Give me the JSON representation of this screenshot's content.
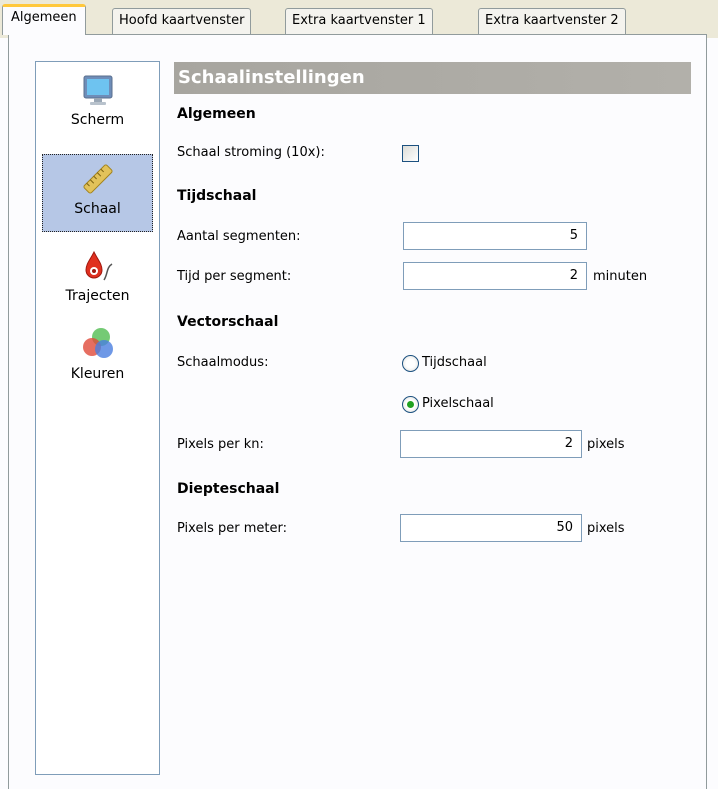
{
  "tabs": [
    {
      "label": "Algemeen",
      "active": true
    },
    {
      "label": "Hoofd kaartvenster",
      "active": false
    },
    {
      "label": "Extra kaartvenster 1",
      "active": false
    },
    {
      "label": "Extra kaartvenster 2",
      "active": false
    }
  ],
  "sidebar": {
    "items": [
      {
        "label": "Scherm",
        "icon": "monitor-icon"
      },
      {
        "label": "Schaal",
        "icon": "ruler-icon",
        "selected": true
      },
      {
        "label": "Trajecten",
        "icon": "track-icon"
      },
      {
        "label": "Kleuren",
        "icon": "colors-icon"
      }
    ]
  },
  "main": {
    "header": "Schaalinstellingen",
    "general": {
      "title": "Algemeen",
      "flow_scale_label": "Schaal stroming (10x):",
      "flow_scale_checked": false
    },
    "time_scale": {
      "title": "Tijdschaal",
      "segments_label": "Aantal segmenten:",
      "segments_value": "5",
      "time_per_segment_label": "Tijd per segment:",
      "time_per_segment_value": "2",
      "time_per_segment_unit": "minuten"
    },
    "vector_scale": {
      "title": "Vectorschaal",
      "mode_label": "Schaalmodus:",
      "option_time": "Tijdschaal",
      "option_pixel": "Pixelschaal",
      "selected": "Pixelschaal",
      "pixels_per_kn_label": "Pixels per kn:",
      "pixels_per_kn_value": "2",
      "pixels_per_kn_unit": "pixels"
    },
    "depth_scale": {
      "title": "Diepteschaal",
      "pixels_per_meter_label": "Pixels per meter:",
      "pixels_per_meter_value": "50",
      "pixels_per_meter_unit": "pixels"
    }
  },
  "colors": {
    "header_bg": "#a9a7a1",
    "tab_active_accent": "#ffc83c",
    "selection_bg": "#b6c7e6",
    "radio_dot": "#21a121"
  }
}
